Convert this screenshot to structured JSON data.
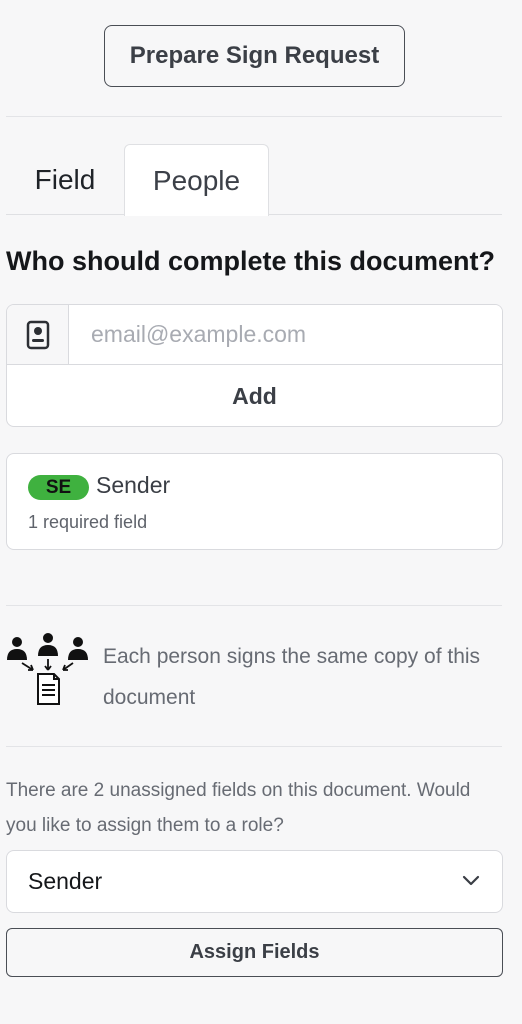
{
  "header": {
    "prepare_button_label": "Prepare Sign Request"
  },
  "tabs": [
    {
      "label": "Field",
      "active": false
    },
    {
      "label": "People",
      "active": true
    }
  ],
  "people_panel": {
    "question": "Who should complete this document?",
    "email_placeholder": "email@example.com",
    "email_value": "",
    "contact_icon": "contact-book-icon",
    "add_label": "Add"
  },
  "recipients": [
    {
      "initials": "SE",
      "name": "Sender",
      "required_fields": "1 required field",
      "badge_color": "#3fb13f"
    }
  ],
  "signing_info": {
    "icon": "people-document-icon",
    "text": "Each person signs the same copy of this document"
  },
  "unassigned": {
    "message": "There are 2 unassigned fields on this document. Would you like to assign them to a role?",
    "role_select_value": "Sender",
    "assign_button_label": "Assign Fields"
  }
}
